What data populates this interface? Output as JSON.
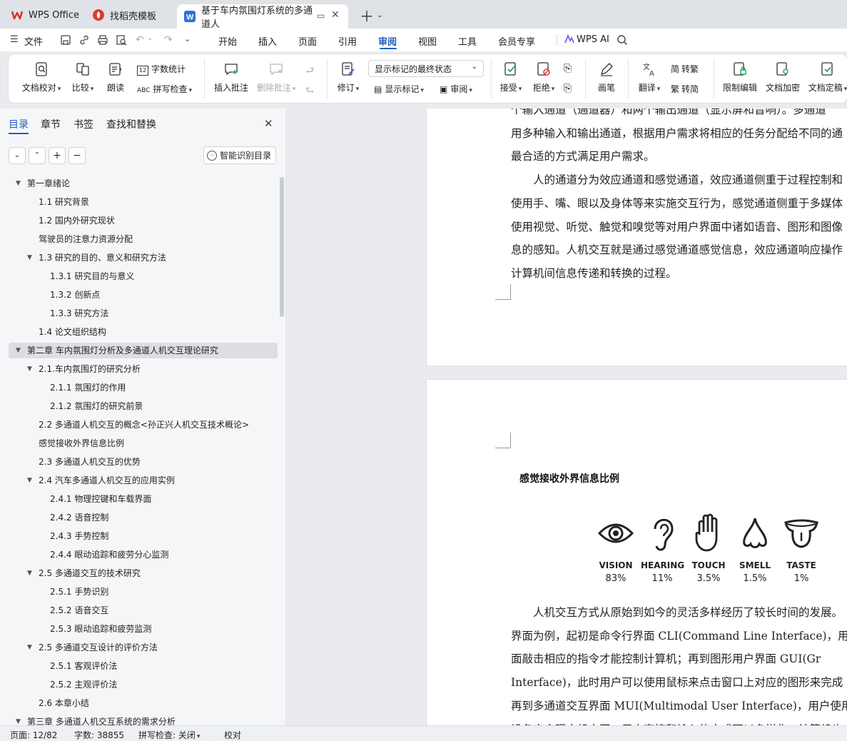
{
  "tabs": [
    {
      "label": "WPS Office",
      "color": "#d0312d"
    },
    {
      "label": "找稻壳模板",
      "color": "#e03a2f"
    },
    {
      "label": "基于车内氛围灯系统的多通道人",
      "color": "#2f6fde"
    }
  ],
  "menubar": {
    "file_label": "文件",
    "items": [
      "开始",
      "插入",
      "页面",
      "引用",
      "审阅",
      "视图",
      "工具",
      "会员专享"
    ],
    "active": "审阅",
    "ai_label": "WPS AI"
  },
  "ribbon": {
    "proofread": "文档校对",
    "compare": "比较",
    "read_aloud": "朗读",
    "word_count": "字数统计",
    "spellcheck": "拼写检查",
    "insert_comment": "插入批注",
    "delete_comment": "删除批注",
    "track": "修订",
    "markup_state": "显示标记的最终状态",
    "show_markup": "显示标记",
    "review": "审阅",
    "accept": "接受",
    "reject": "拒绝",
    "pen": "画笔",
    "translate": "翻译",
    "to_traditional": "转繁",
    "to_simplified": "转简",
    "restrict_edit": "限制编辑",
    "encrypt": "文档加密",
    "finalize": "文档定稿"
  },
  "sidebar": {
    "tabs": [
      "目录",
      "章节",
      "书签",
      "查找和替换"
    ],
    "smart_label": "智能识别目录",
    "toc": [
      {
        "t": "第一章绪论",
        "lvl": 0,
        "arrow": true
      },
      {
        "t": "1.1 研究背景",
        "lvl": 1
      },
      {
        "t": "1.2 国内外研究现状",
        "lvl": 1
      },
      {
        "t": "驾驶员的注意力资源分配",
        "lvl": 1
      },
      {
        "t": "1.3 研究的目的、意义和研究方法",
        "lvl": 1,
        "arrow": true
      },
      {
        "t": "1.3.1 研究目的与意义",
        "lvl": 2
      },
      {
        "t": "1.3.2 创新点",
        "lvl": 2
      },
      {
        "t": "1.3.3 研究方法",
        "lvl": 2
      },
      {
        "t": "1.4 论文组织结构",
        "lvl": 1
      },
      {
        "t": "第二章  车内氛围灯分析及多通道人机交互理论研究",
        "lvl": 0,
        "arrow": true,
        "sel": true
      },
      {
        "t": "2.1.车内氛围灯的研究分析",
        "lvl": 1,
        "arrow": true
      },
      {
        "t": "2.1.1 氛围灯的作用",
        "lvl": 2
      },
      {
        "t": "2.1.2 氛围灯的研究前景",
        "lvl": 2
      },
      {
        "t": "2.2  多通道人机交互的概念<孙正兴人机交互技术概论>",
        "lvl": 1
      },
      {
        "t": "感觉接收外界信息比例",
        "lvl": 1
      },
      {
        "t": "2.3 多通道人机交互的优势",
        "lvl": 1
      },
      {
        "t": "2.4 汽车多通道人机交互的应用实例",
        "lvl": 1,
        "arrow": true
      },
      {
        "t": "2.4.1 物理控键和车载界面",
        "lvl": 2
      },
      {
        "t": "2.4.2 语音控制",
        "lvl": 2
      },
      {
        "t": "2.4.3 手势控制",
        "lvl": 2
      },
      {
        "t": "2.4.4 眼动追踪和疲劳分心监测",
        "lvl": 2
      },
      {
        "t": "2.5 多通道交互的技术研究",
        "lvl": 1,
        "arrow": true
      },
      {
        "t": "2.5.1 手势识别",
        "lvl": 2
      },
      {
        "t": "2.5.2 语音交互",
        "lvl": 2
      },
      {
        "t": "2.5.3 眼动追踪和疲劳监测",
        "lvl": 2
      },
      {
        "t": "2.5 多通道交互设计的评价方法",
        "lvl": 1,
        "arrow": true
      },
      {
        "t": "2.5.1 客观评价法",
        "lvl": 2
      },
      {
        "t": "2.5.2 主观评价法",
        "lvl": 2
      },
      {
        "t": "2.6 本章小结",
        "lvl": 1
      },
      {
        "t": "第三章  多通道人机交互系统的需求分析",
        "lvl": 0,
        "arrow": true
      }
    ]
  },
  "doc": {
    "page1_lines": [
      "个输入通道（通道器）和两个输出通道（显示屏和音响）。多通道",
      "用多种输入和输出通道，根据用户需求将相应的任务分配给不同的通",
      "最合适的方式满足用户需求。",
      "　　人的通道分为效应通道和感觉通道，效应通道侧重于过程控制和",
      "使用手、嘴、眼以及身体等来实施交互行为，感觉通道侧重于多媒体",
      "使用视觉、听觉、触觉和嗅觉等对用户界面中诸如语音、图形和图像",
      "息的感知。人机交互就是通过感觉通道感觉信息，效应通道响应操作",
      "计算机间信息传递和转换的过程。"
    ],
    "figure_title": "感觉接收外界信息比例",
    "senses": [
      {
        "name": "VISION",
        "pct": "83%",
        "icon": "eye-icon"
      },
      {
        "name": "HEARING",
        "pct": "11%",
        "icon": "ear-icon"
      },
      {
        "name": "TOUCH",
        "pct": "3.5%",
        "icon": "hand-icon"
      },
      {
        "name": "SMELL",
        "pct": "1.5%",
        "icon": "nose-icon"
      },
      {
        "name": "TASTE",
        "pct": "1%",
        "icon": "tongue-icon"
      }
    ],
    "page2_lines": [
      "　　人机交互方式从原始到如今的灵活多样经历了较长时间的发展。",
      "界面为例，起初是命令行界面 CLI(Command Line Interface)，用户需",
      "面敲击相应的指令才能控制计算机；再到图形用户界面 GUI(Gr",
      "Interface)，此时用户可以使用鼠标来点击窗口上对应的图形来完成",
      "再到多通道交互界面 MUI(Multimodal User Interface)，用户使用各种",
      "设备来实现人机交互，用户直接和输入的方式可以多样化，计算机也"
    ]
  },
  "status": {
    "page": "页面: 12/82",
    "words": "字数: 38855",
    "spell": "拼写检查: 关闭",
    "proof": "校对"
  }
}
